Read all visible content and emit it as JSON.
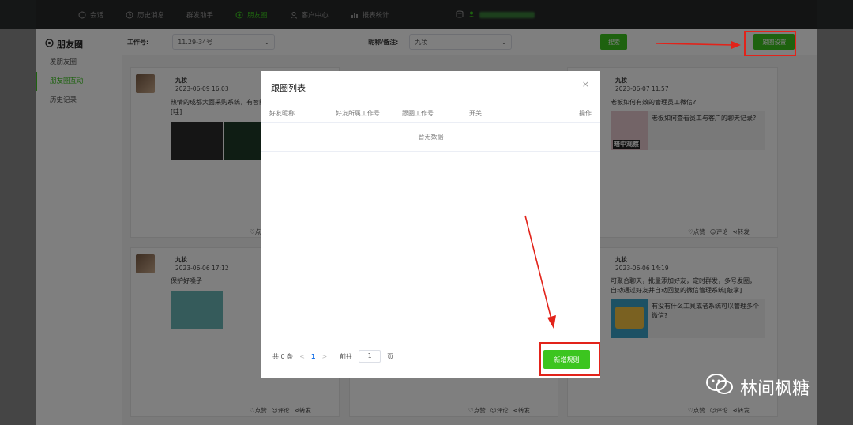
{
  "topnav": {
    "items": [
      {
        "label": "会话",
        "icon": "chat-icon"
      },
      {
        "label": "历史消息",
        "icon": "clock-icon"
      },
      {
        "label": "群发助手",
        "icon": ""
      },
      {
        "label": "朋友圈",
        "icon": "moments-icon",
        "active": true
      },
      {
        "label": "客户中心",
        "icon": "user-icon"
      },
      {
        "label": "报表统计",
        "icon": "chart-icon"
      }
    ]
  },
  "sidebar": {
    "title": "朋友圈",
    "items": [
      {
        "label": "发朋友圈"
      },
      {
        "label": "朋友圈互动",
        "active": true
      },
      {
        "label": "历史记录"
      }
    ]
  },
  "filter": {
    "account_label": "工作号:",
    "account_value": "11.29-34号",
    "nickname_label": "昵称/备注:",
    "nickname_value": "九妆",
    "search_label": "搜索",
    "follow_settings_label": "跟圈设置"
  },
  "cards": [
    {
      "name": "九妆",
      "date": "2023-06-09 16:03",
      "text": "热情的成都大面采购系统，有智能\n[哇]",
      "like": "♡点"
    },
    {
      "name": "九妆",
      "date": "2023-06-07 11:57",
      "text": "老板如何有效的管理员工微信?",
      "link_text": "老板如何查看员工与客户的聊天记录?",
      "thumb_caption": "暗中观察",
      "like": "♡点赞",
      "comment": "评论",
      "share": "转发"
    },
    {
      "name": "九妆",
      "date": "2023-06-06 17:12",
      "text": "保护好嗓子",
      "like": "♡点赞",
      "comment": "评论",
      "share": "转发"
    },
    {
      "name": "九妆",
      "date": "2023-06-06 14:19",
      "text": "可聚合聊天，批量添加好友，定时群发，多号发圈，\n自动通过好友并自动回复的微信管理系统[敲掌]",
      "link_text": "有没有什么工具或者系统可以管理多个微信?",
      "like": "♡点赞",
      "comment": "评论",
      "share": "转发"
    },
    {
      "like": "♡点赞",
      "comment": "评论",
      "share": "转发"
    }
  ],
  "dialog": {
    "title": "跟圈列表",
    "columns": [
      "好友昵称",
      "好友所属工作号",
      "跟圈工作号",
      "开关",
      "操作"
    ],
    "empty_text": "暂无数据",
    "total": "共 0 条",
    "prev": "<",
    "current_page": "1",
    "next": ">",
    "goto_label": "前往",
    "goto_value": "1",
    "page_unit": "页",
    "add_rule_label": "新增规则"
  },
  "watermark": "林间枫糖",
  "colors": {
    "brand_green": "#3cc51f",
    "annotation_red": "#e2231a"
  }
}
